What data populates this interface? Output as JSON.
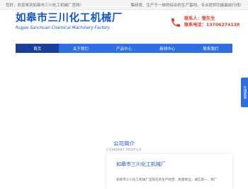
{
  "topbar": {
    "welcome": "您好，欢迎来到如皋市三川化工机械厂官网！",
    "slogan": "集研发、生产于一体的综合的生产基地，专业提供功能最前行线！"
  },
  "header": {
    "company_cn": "如皋市三川化工机械厂",
    "company_en": "Rugao Sanchuan Chemical Machinery Factory",
    "contact_person": "联系人：管先生",
    "contact_phone": "联系电话：13706274138"
  },
  "nav": {
    "items": [
      {
        "label": "首页"
      },
      {
        "label": "关于我们"
      },
      {
        "label": "产品中心"
      },
      {
        "label": "新闻中心"
      },
      {
        "label": "联系我们"
      }
    ]
  },
  "about": {
    "title_cn": "公司简介",
    "title_en": "COMPANY PROFILE",
    "card_title": "如皋市三川化工机械厂",
    "card_desc": "如皋市三川化工机械厂是现在的生产经营，质量保证，诚信第一，我厂"
  },
  "side_float": {
    "label": "在线客服"
  },
  "colors": {
    "brand_blue": "#1156c4",
    "nav_blue": "#2b6fe0",
    "nav_active": "#1a3e9b",
    "contact_red": "#e53a1f"
  }
}
